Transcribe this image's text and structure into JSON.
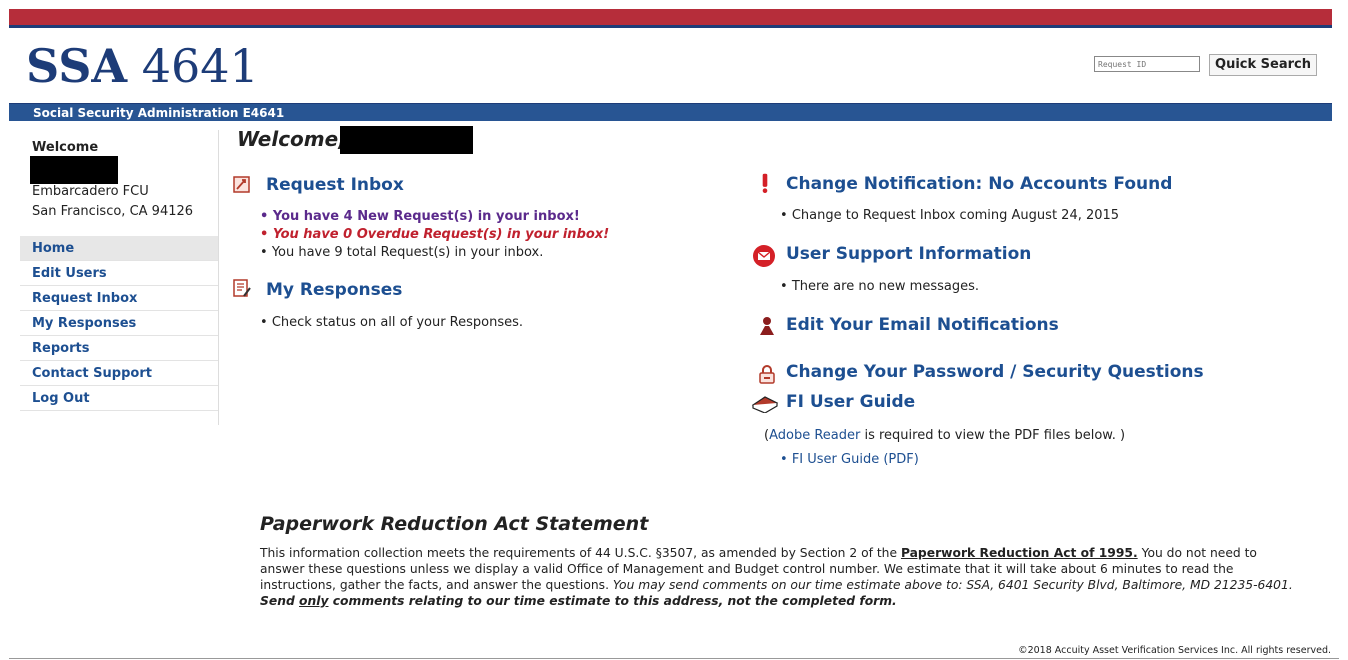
{
  "header": {
    "logo_bold": "SSA",
    "logo_num": "4641",
    "search_placeholder": "Request ID",
    "search_button": "Quick Search",
    "subtitle": "Social Security Administration E4641"
  },
  "sidebar": {
    "welcome": "Welcome",
    "org": "Embarcadero FCU",
    "city": "San Francisco, CA 94126",
    "items": [
      {
        "label": "Home"
      },
      {
        "label": "Edit Users"
      },
      {
        "label": "Request Inbox"
      },
      {
        "label": "My Responses"
      },
      {
        "label": "Reports"
      },
      {
        "label": "Contact Support"
      },
      {
        "label": "Log Out"
      }
    ]
  },
  "main": {
    "welcome": "Welcome,",
    "request_inbox": {
      "title": "Request Inbox",
      "new": "You have 4 New Request(s) in your inbox!",
      "overdue": "You have 0 Overdue Request(s) in your inbox!",
      "total": "You have 9 total Request(s) in your inbox."
    },
    "my_responses": {
      "title": "My Responses",
      "item": "Check status on all of your Responses."
    },
    "change_notification": {
      "title": "Change Notification: No Accounts Found",
      "item": "Change to Request Inbox coming August 24, 2015"
    },
    "user_support": {
      "title": "User Support Information",
      "item": "There are no new messages."
    },
    "edit_email": {
      "title": "Edit Your Email Notifications"
    },
    "change_password": {
      "title": "Change Your Password / Security Questions"
    },
    "user_guide": {
      "title": "FI User Guide",
      "note_link": "Adobe Reader",
      "note_open": "(",
      "note_rest": " is required to view the PDF files below. )",
      "pdf": "FI User Guide (PDF)"
    }
  },
  "pra": {
    "title": "Paperwork Reduction Act Statement",
    "p1": "This information collection meets the requirements of 44 U.S.C. §3507, as amended by Section 2 of the ",
    "link": "Paperwork Reduction Act of 1995.",
    "p2": " You do not need to answer these questions unless we display a valid Office of Management and Budget control number. We estimate that it will take about 6 minutes to read the instructions, gather the facts, and answer the questions. ",
    "p3": "You may send comments on our time estimate above to: SSA, 6401 Security Blvd, Baltimore, MD 21235-6401.",
    "p4a": " Send ",
    "p4b": "only",
    "p4c": " comments relating to our time estimate to this address, not the completed form."
  },
  "footer": {
    "copyright": "©2018 Accuity Asset Verification Services Inc. All rights reserved."
  },
  "colors": {
    "brand_blue": "#1d4f91",
    "bar_red": "#b62d3a",
    "link_blue": "#1d4f91"
  },
  "icons": [
    "inbox-icon",
    "responses-icon",
    "exclamation-icon",
    "mail-icon",
    "user-icon",
    "lock-icon",
    "book-icon"
  ]
}
